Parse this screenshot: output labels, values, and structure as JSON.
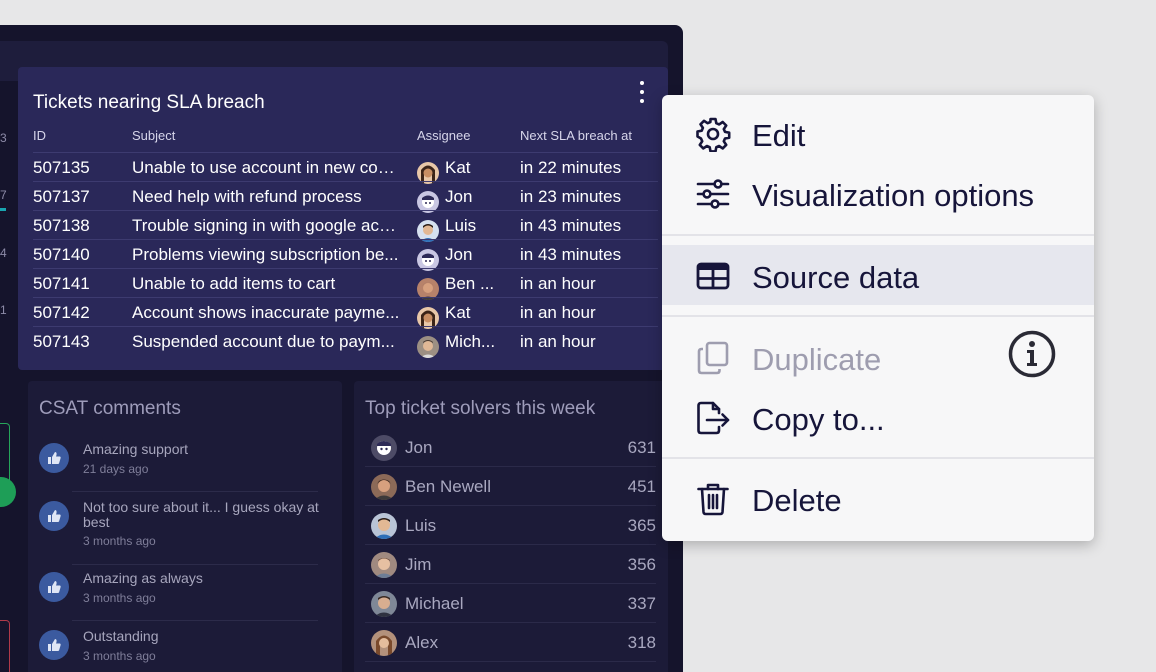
{
  "edge_numbers": [
    "3",
    "7",
    "4",
    "1"
  ],
  "sla_card": {
    "title": "Tickets nearing SLA breach",
    "columns": [
      "ID",
      "Subject",
      "Assignee",
      "Next SLA breach at"
    ],
    "rows": [
      {
        "id": "507135",
        "subject": "Unable to use account in new cou...",
        "assignee": "Kat",
        "next": "in 22 minutes"
      },
      {
        "id": "507137",
        "subject": "Need help with refund process",
        "assignee": "Jon",
        "next": "in 23 minutes"
      },
      {
        "id": "507138",
        "subject": "Trouble signing in with google acc...",
        "assignee": "Luis",
        "next": "in 43 minutes"
      },
      {
        "id": "507140",
        "subject": "Problems viewing subscription be...",
        "assignee": "Jon",
        "next": "in 43 minutes"
      },
      {
        "id": "507141",
        "subject": "Unable to add items to cart",
        "assignee": "Ben ...",
        "next": "in an hour"
      },
      {
        "id": "507142",
        "subject": "Account shows inaccurate payme...",
        "assignee": "Kat",
        "next": "in an hour"
      },
      {
        "id": "507143",
        "subject": "Suspended account due to paym...",
        "assignee": "Mich...",
        "next": "in an hour"
      }
    ]
  },
  "csat": {
    "title": "CSAT comments",
    "items": [
      {
        "text": "Amazing support",
        "time": "21 days ago"
      },
      {
        "text": "Not too sure about it... I guess okay at best",
        "time": "3 months ago"
      },
      {
        "text": "Amazing as always",
        "time": "3 months ago"
      },
      {
        "text": "Outstanding",
        "time": "3 months ago"
      }
    ]
  },
  "solvers": {
    "title": "Top ticket solvers this week",
    "rows": [
      {
        "name": "Jon",
        "count": "631"
      },
      {
        "name": "Ben Newell",
        "count": "451"
      },
      {
        "name": "Luis",
        "count": "365"
      },
      {
        "name": "Jim",
        "count": "356"
      },
      {
        "name": "Michael",
        "count": "337"
      },
      {
        "name": "Alex",
        "count": "318"
      }
    ]
  },
  "menu": {
    "edit": "Edit",
    "visualization": "Visualization options",
    "source_data": "Source data",
    "duplicate": "Duplicate",
    "copy_to": "Copy to...",
    "delete": "Delete"
  },
  "colors": {
    "dashboard_bg": "#15142c",
    "card_bg": "#2a2859",
    "menu_bg": "#f7f7f8",
    "menu_active": "#e6e7ee",
    "menu_text": "#16153a"
  }
}
